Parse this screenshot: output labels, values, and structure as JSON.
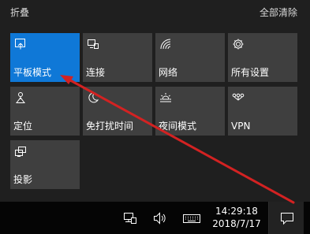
{
  "header": {
    "collapse_label": "折叠",
    "clear_all_label": "全部清除"
  },
  "tiles": [
    {
      "label": "平板模式",
      "icon": "tablet-mode-icon",
      "active": true
    },
    {
      "label": "连接",
      "icon": "connect-icon",
      "active": false
    },
    {
      "label": "网络",
      "icon": "network-icon",
      "active": false
    },
    {
      "label": "所有设置",
      "icon": "gear-icon",
      "active": false
    },
    {
      "label": "定位",
      "icon": "location-icon",
      "active": false
    },
    {
      "label": "免打扰时间",
      "icon": "moon-icon",
      "active": false
    },
    {
      "label": "夜间模式",
      "icon": "brightness-icon",
      "active": false
    },
    {
      "label": "VPN",
      "icon": "vpn-icon",
      "active": false
    },
    {
      "label": "投影",
      "icon": "project-icon",
      "active": false
    }
  ],
  "taskbar": {
    "time": "14:29:18",
    "date": "2018/7/17",
    "tray_icons": [
      "network-tray-icon",
      "volume-icon",
      "keyboard-icon"
    ],
    "action_center_icon": "action-center-icon"
  },
  "colors": {
    "accent": "#0f78d7",
    "tile": "#3f3f3f",
    "panel": "#1f1f1f",
    "taskbar": "#050505",
    "arrow": "#d32222"
  }
}
